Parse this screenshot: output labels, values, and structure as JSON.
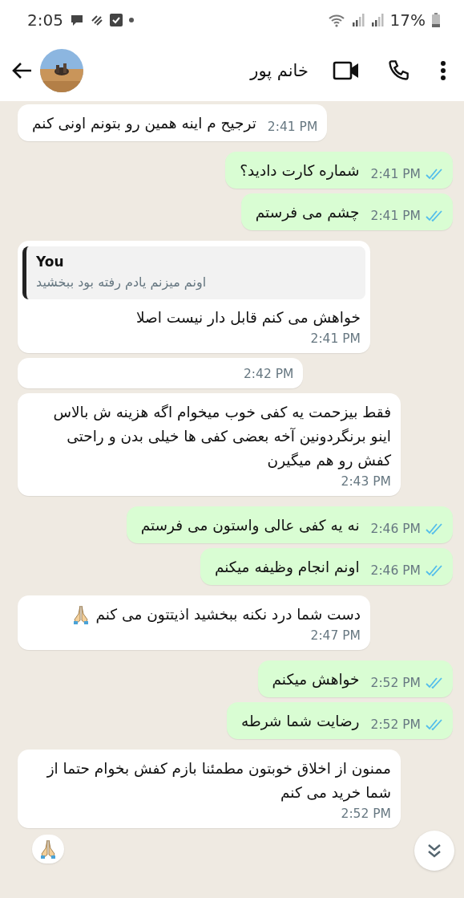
{
  "status_bar": {
    "time": "2:05",
    "battery": "17%"
  },
  "header": {
    "title": "خانم پور"
  },
  "messages": [
    {
      "kind": "incoming",
      "text": "ترجیح م اینه همین رو بتونم اونی کنم",
      "time": "2:41 PM"
    },
    {
      "kind": "outgoing",
      "text": "شماره کارت دادید؟",
      "time": "2:41 PM",
      "read": true
    },
    {
      "kind": "outgoing",
      "text": "چشم می فرستم",
      "time": "2:41 PM",
      "read": true
    },
    {
      "kind": "incoming",
      "quote": {
        "author": "You",
        "text": "اونم میزنم یادم رفته بود ببخشید"
      },
      "text": "خواهش می کنم قابل دار نیست اصلا",
      "time": "2:41 PM"
    },
    {
      "kind": "incoming",
      "time": "2:42 PM"
    },
    {
      "kind": "incoming",
      "text": "فقط بیزحمت یه کفی خوب میخوام اگه هزینه ش بالاس اینو برنگردونین آخه بعضی کفی ها خیلی بدن و راحتی کفش رو هم میگیرن",
      "time": "2:43 PM"
    },
    {
      "kind": "outgoing",
      "text": "نه یه کفی عالی واستون می فرستم",
      "time": "2:46 PM",
      "read": true
    },
    {
      "kind": "outgoing",
      "text": "اونم انجام وظیفه میکنم",
      "time": "2:46 PM",
      "read": true
    },
    {
      "kind": "incoming",
      "text": "دست شما درد نکنه ببخشید اذیتتون می کنم",
      "emoji": true,
      "time": "2:47 PM"
    },
    {
      "kind": "outgoing",
      "text": "خواهش میکنم",
      "time": "2:52 PM",
      "read": true
    },
    {
      "kind": "outgoing",
      "text": "رضایت شما شرطه",
      "time": "2:52 PM",
      "read": true
    },
    {
      "kind": "incoming",
      "text": "ممنون از اخلاق خوبتون مطمئنا بازم کفش بخوام حتما از شما خرید می کنم",
      "time": "2:52 PM",
      "reaction": true
    }
  ]
}
